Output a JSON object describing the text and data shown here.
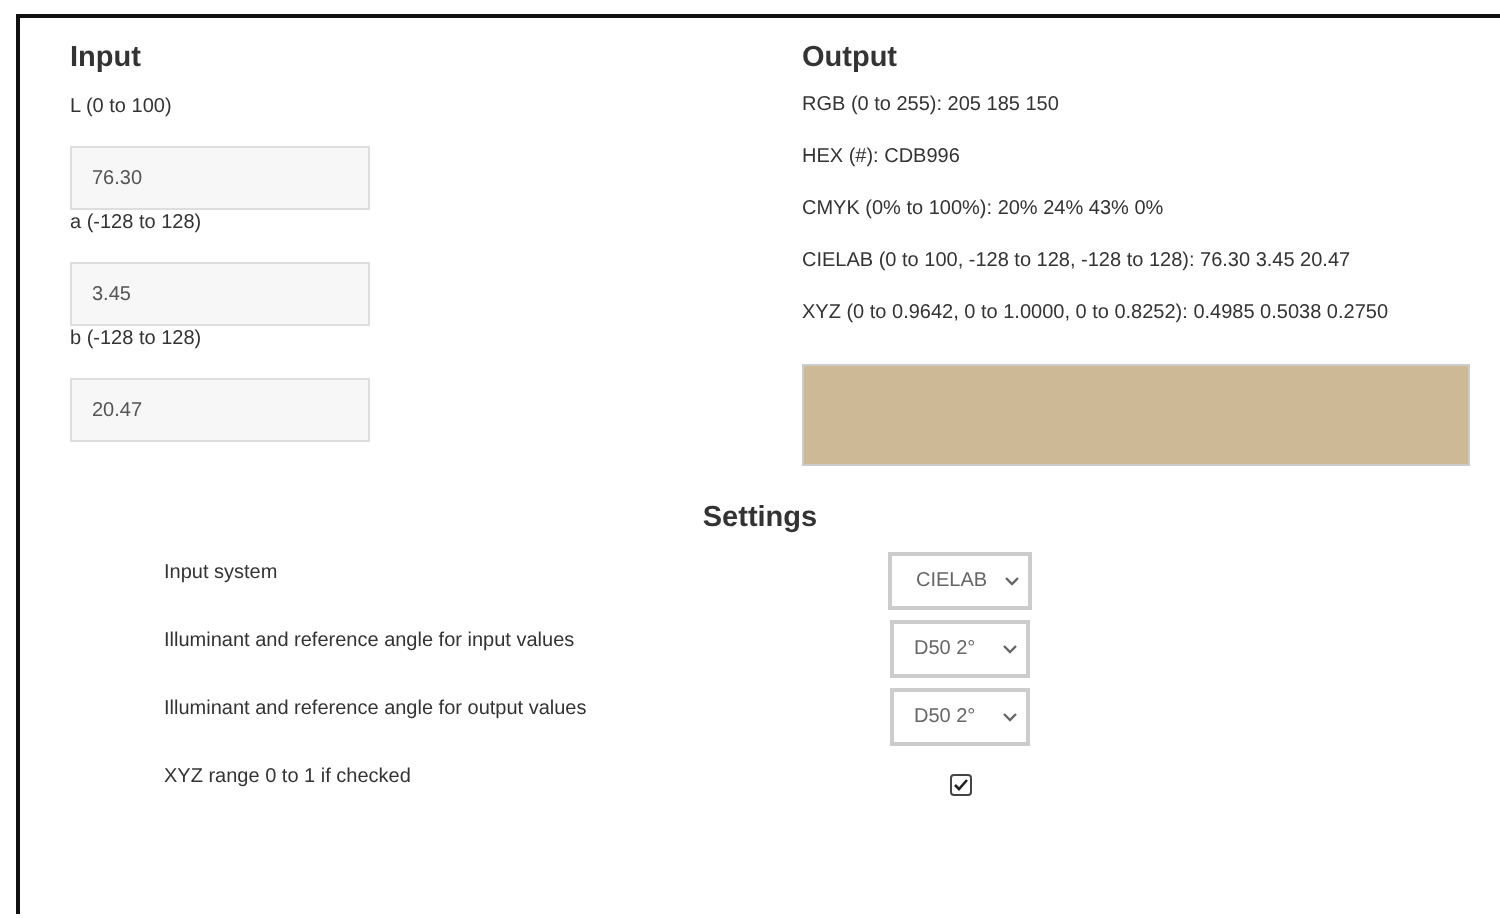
{
  "input": {
    "title": "Input",
    "fields": [
      {
        "label": "L (0 to 100)",
        "value": "76.30"
      },
      {
        "label": "a (-128 to 128)",
        "value": "3.45"
      },
      {
        "label": "b (-128 to 128)",
        "value": "20.47"
      }
    ]
  },
  "output": {
    "title": "Output",
    "lines": [
      "RGB (0 to 255): 205 185 150",
      "HEX (#): CDB996",
      "CMYK (0% to 100%): 20% 24% 43% 0%",
      "CIELAB (0 to 100, -128 to 128, -128 to 128): 76.30 3.45 20.47",
      "XYZ (0 to 0.9642, 0 to 1.0000, 0 to 0.8252): 0.4985 0.5038 0.2750"
    ],
    "swatch": {
      "color": "#cdb996"
    }
  },
  "settings": {
    "title": "Settings",
    "rows": [
      {
        "kind": "select",
        "label": "Input system",
        "value": "CIELAB"
      },
      {
        "kind": "select",
        "label": "Illuminant and reference angle for input values",
        "value": "D50 2°"
      },
      {
        "kind": "select",
        "label": "Illuminant and reference angle for output values",
        "value": "D50 2°"
      },
      {
        "kind": "checkbox",
        "label": "XYZ range 0 to 1 if checked",
        "checked": true
      }
    ]
  }
}
